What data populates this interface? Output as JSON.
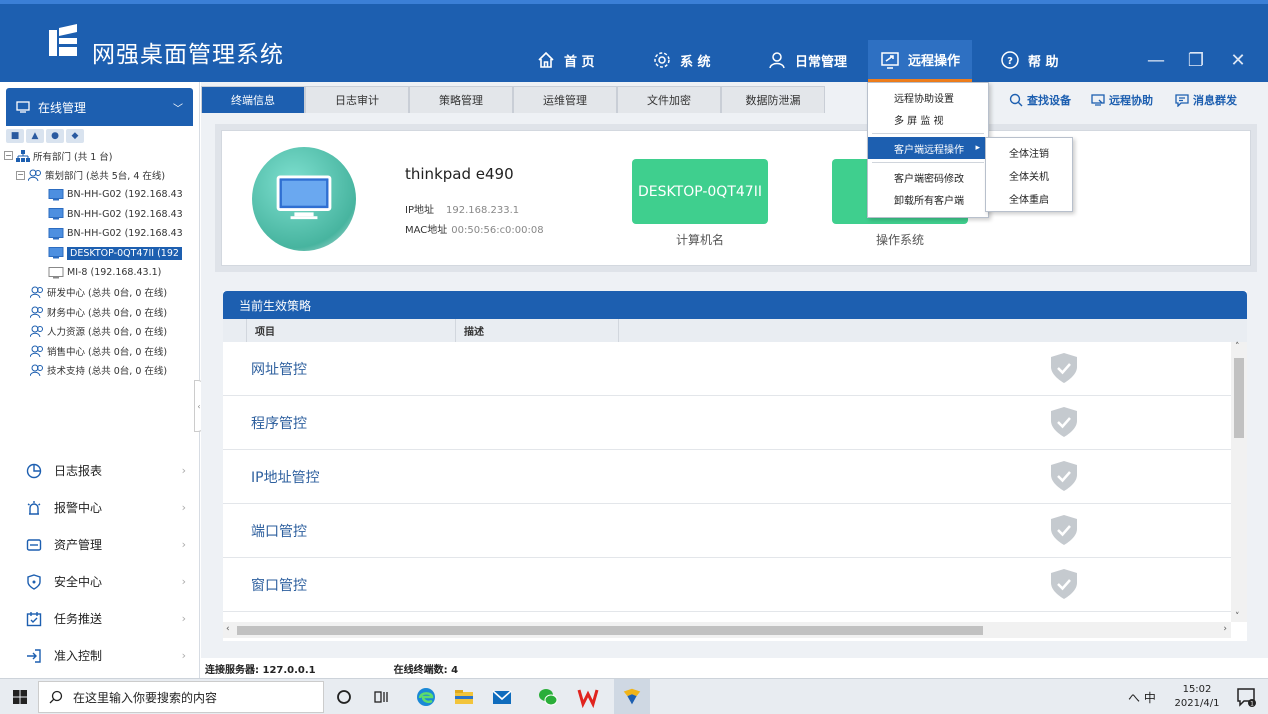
{
  "app": {
    "title": "网强桌面管理系统"
  },
  "nav": [
    {
      "label": "首 页",
      "icon": "home-icon"
    },
    {
      "label": "系 统",
      "icon": "gear-icon"
    },
    {
      "label": "日常管理",
      "icon": "user-icon"
    },
    {
      "label": "远程操作",
      "icon": "remote-screen-icon"
    },
    {
      "label": "帮 助",
      "icon": "help-icon"
    }
  ],
  "window_controls": {
    "minimize": "—",
    "maximize": "❐",
    "close": "✕"
  },
  "sidebar": {
    "header": "在线管理",
    "tree": [
      {
        "label": "所有部门 (共 1 台)",
        "level": 0
      },
      {
        "label": "策划部门 (总共 5台, 4 在线)",
        "level": 1
      },
      {
        "label": "BN-HH-G02 (192.168.43",
        "level": 2
      },
      {
        "label": "BN-HH-G02 (192.168.43",
        "level": 2
      },
      {
        "label": "BN-HH-G02 (192.168.43",
        "level": 2
      },
      {
        "label": "DESKTOP-0QT47II (192",
        "level": 2,
        "selected": true
      },
      {
        "label": "MI-8 (192.168.43.1)",
        "level": 2
      },
      {
        "label": "研发中心 (总共 0台, 0 在线)",
        "level": 1
      },
      {
        "label": "财务中心 (总共 0台, 0 在线)",
        "level": 1
      },
      {
        "label": "人力资源 (总共 0台, 0 在线)",
        "level": 1
      },
      {
        "label": "销售中心 (总共 0台, 0 在线)",
        "level": 1
      },
      {
        "label": "技术支持 (总共 0台, 0 在线)",
        "level": 1
      }
    ],
    "menu": [
      {
        "label": "日志报表",
        "icon": "pie-chart-icon"
      },
      {
        "label": "报警中心",
        "icon": "alarm-icon"
      },
      {
        "label": "资产管理",
        "icon": "asset-icon"
      },
      {
        "label": "安全中心",
        "icon": "shield-icon"
      },
      {
        "label": "任务推送",
        "icon": "calendar-icon"
      },
      {
        "label": "准入控制",
        "icon": "login-icon"
      }
    ]
  },
  "tabs": [
    "终端信息",
    "日志审计",
    "策略管理",
    "运维管理",
    "文件加密",
    "数据防泄漏"
  ],
  "tools": [
    {
      "label": "查找设备",
      "icon": "search-icon"
    },
    {
      "label": "远程协助",
      "icon": "remote-assist-icon"
    },
    {
      "label": "消息群发",
      "icon": "message-icon"
    }
  ],
  "terminal": {
    "name": "thinkpad e490",
    "ip_label": "IP地址",
    "ip": "192.168.233.1",
    "mac_label": "MAC地址",
    "mac": "00:50:56:c0:00:08",
    "computer_name": "DESKTOP-0QT47II",
    "computer_name_label": "计算机名",
    "os_label": "操作系统"
  },
  "policy": {
    "title": "当前生效策略",
    "columns": [
      "项目",
      "描述"
    ],
    "rows": [
      "网址管控",
      "程序管控",
      "IP地址管控",
      "端口管控",
      "窗口管控"
    ]
  },
  "status": {
    "server": "连接服务器: 127.0.0.1",
    "online": "在线终端数: 4"
  },
  "dropdown": {
    "items": [
      "远程协助设置",
      "多 屏 监 视",
      "客户端远程操作",
      "客户端密码修改",
      "卸载所有客户端"
    ],
    "highlighted": "客户端远程操作",
    "submenu": [
      "全体注销",
      "全体关机",
      "全体重启"
    ]
  },
  "taskbar": {
    "search_placeholder": "在这里输入你要搜索的内容",
    "ime": "へ 中",
    "time": "15:02",
    "date": "2021/4/1"
  },
  "colors": {
    "primary": "#1d5fb0",
    "accent": "#f07e1c",
    "green": "#3fcf8e"
  }
}
